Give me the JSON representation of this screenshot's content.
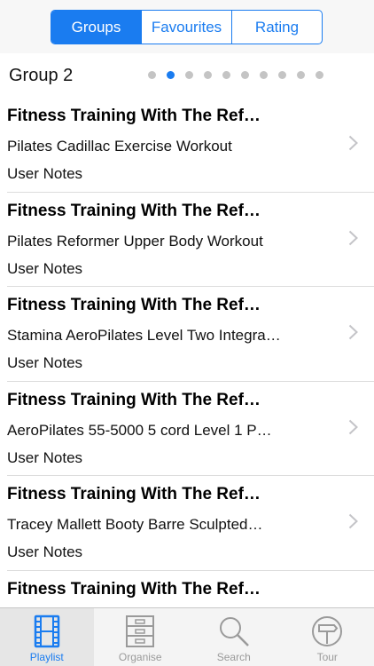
{
  "segments": [
    "Groups",
    "Favourites",
    "Rating"
  ],
  "group": {
    "title": "Group 2",
    "page_count": 10,
    "active_page": 2
  },
  "rows": [
    {
      "title": "Fitness Training With The Ref…",
      "subtitle": "Pilates Cadillac Exercise Workout",
      "notes": "User Notes"
    },
    {
      "title": "Fitness Training With The Ref…",
      "subtitle": "Pilates Reformer Upper Body Workout",
      "notes": "User Notes"
    },
    {
      "title": "Fitness Training With The Ref…",
      "subtitle": "Stamina AeroPilates Level Two Integra…",
      "notes": "User Notes"
    },
    {
      "title": "Fitness Training With The Ref…",
      "subtitle": "AeroPilates 55-5000 5 cord Level 1 P…",
      "notes": "User Notes"
    },
    {
      "title": "Fitness Training With The Ref…",
      "subtitle": "Tracey Mallett Booty Barre  Sculpted…",
      "notes": "User Notes"
    },
    {
      "title": "Fitness Training With The Ref…",
      "subtitle": "",
      "notes": ""
    }
  ],
  "tabs": [
    {
      "label": "Playlist",
      "icon": "film-icon"
    },
    {
      "label": "Organise",
      "icon": "cabinet-icon"
    },
    {
      "label": "Search",
      "icon": "search-icon"
    },
    {
      "label": "Tour",
      "icon": "signpost-icon"
    }
  ],
  "colors": {
    "accent": "#1a7cf0",
    "inactive": "#9a9a9a"
  }
}
